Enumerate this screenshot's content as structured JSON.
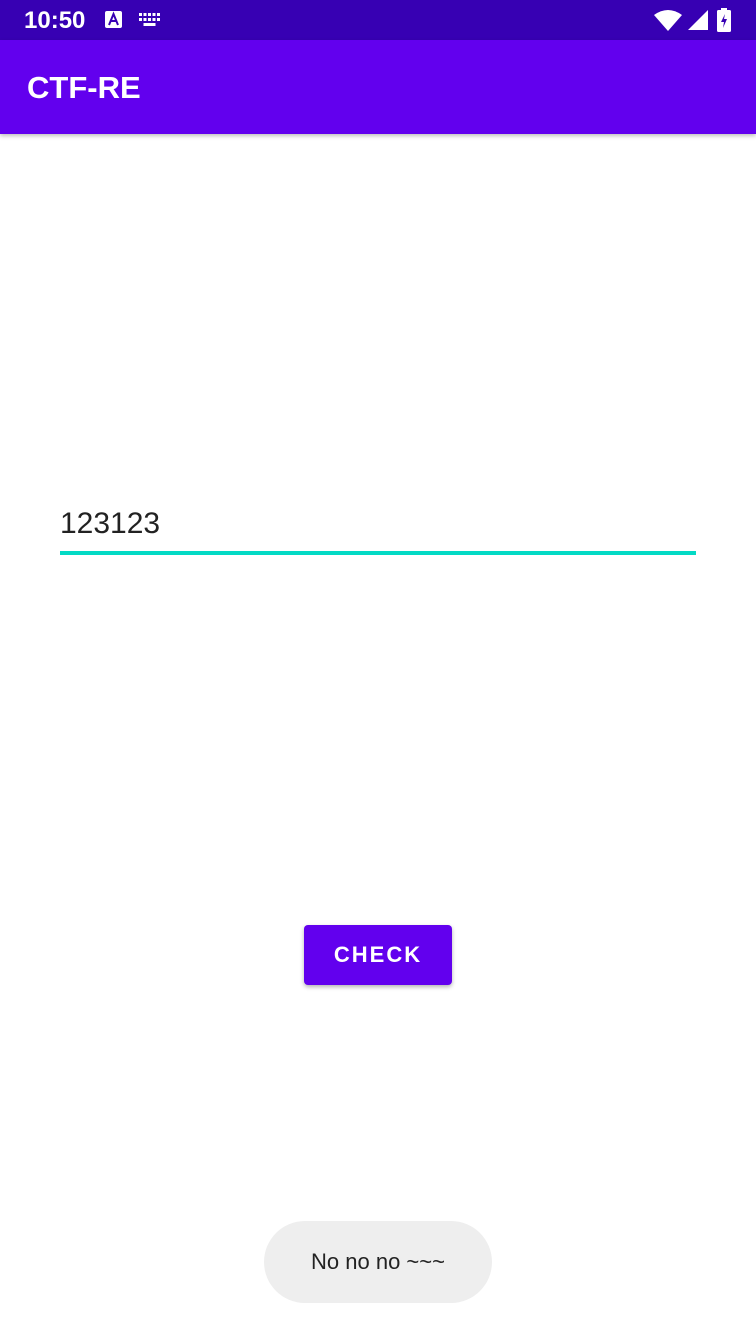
{
  "status_bar": {
    "time": "10:50",
    "background_color": "#3700B3",
    "icons": [
      "accessibility-a-icon",
      "keyboard-icon",
      "wifi-icon",
      "signal-icon",
      "battery-icon"
    ]
  },
  "app_bar": {
    "title": "CTF-RE",
    "background_color": "#6200EE"
  },
  "input": {
    "value": "123123",
    "underline_color": "#03DAC5"
  },
  "check_button": {
    "label": "CHECK",
    "background_color": "#6200EE"
  },
  "toast": {
    "message": "No no no ~~~"
  }
}
